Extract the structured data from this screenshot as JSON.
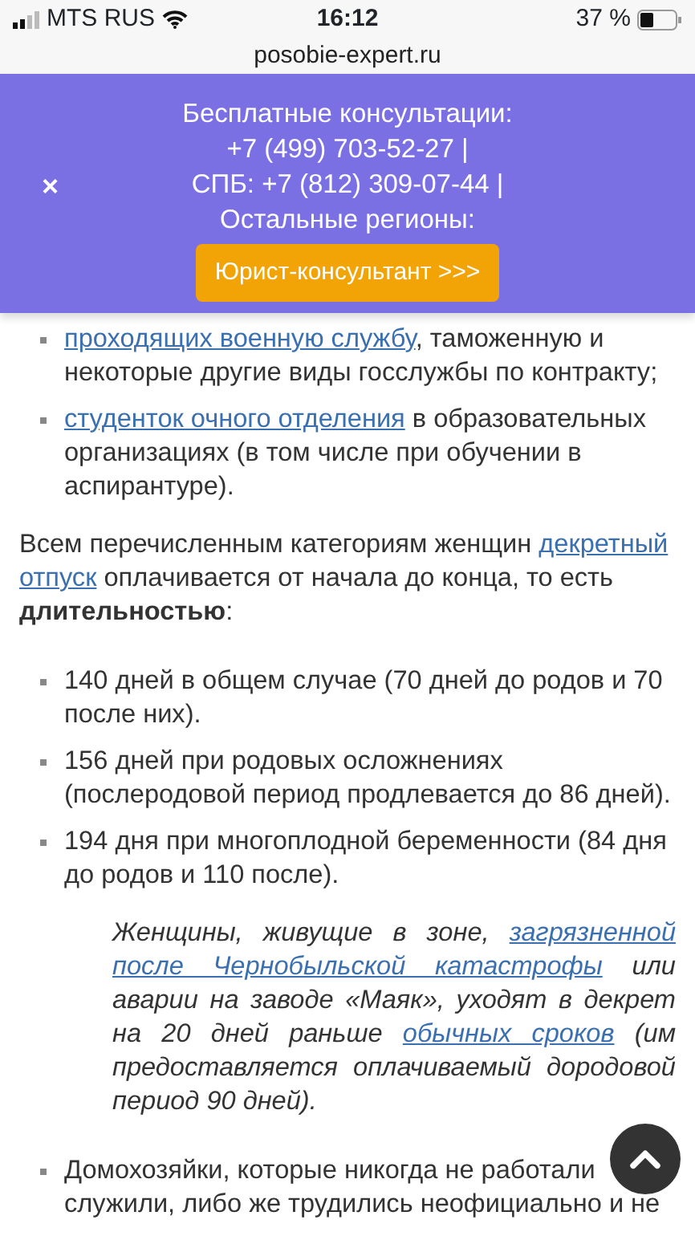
{
  "status_bar": {
    "carrier": "MTS RUS",
    "time": "16:12",
    "battery": "37 %"
  },
  "address_bar": {
    "url": "posobie-expert.ru"
  },
  "banner": {
    "close": "×",
    "lines": [
      "Бесплатные консультации:",
      "+7 (499) 703-52-27 |",
      "СПБ: +7 (812) 309-07-44 |",
      "Остальные регионы:"
    ],
    "button": "Юрист-консультант >>>"
  },
  "content": [
    {
      "kind": "bullets",
      "items": [
        [
          {
            "text": "проходящих военную службу",
            "kind": "link"
          },
          {
            "text": ", таможенную и некоторые другие виды госслужбы по контракту;",
            "kind": "text"
          }
        ],
        [
          {
            "text": "студенток очного отделения",
            "kind": "link"
          },
          {
            "text": " в образовательных организациях (в том числе при обучении в аспирантуре).",
            "kind": "text"
          }
        ]
      ]
    },
    {
      "kind": "paragraph",
      "segments": [
        {
          "text": "Всем перечисленным категориям женщин ",
          "kind": "text"
        },
        {
          "text": "декретный",
          "kind": "link"
        },
        {
          "text": "отпуск",
          "kind": "link"
        },
        {
          "text": " оплачивается от начала до конца, то есть ",
          "kind": "text"
        },
        {
          "text": "длительностью",
          "kind": "bold"
        },
        {
          "text": ":",
          "kind": "text"
        }
      ]
    },
    {
      "kind": "bullets",
      "items": [
        [
          {
            "text": "140 дней в общем случае (70 дней до родов и 70 после них).",
            "kind": "text"
          }
        ],
        [
          {
            "text": "156 дней при родовых осложнениях (послеродовой период продлевается до 86 дней).",
            "kind": "text"
          }
        ],
        [
          {
            "text": "194 дня при многоплодной беременности (84 дня до родов и 110 после).",
            "kind": "text"
          }
        ]
      ]
    },
    {
      "kind": "quote",
      "segments": [
        {
          "text": "Женщины, живущие в зоне, ",
          "kind": "text"
        },
        {
          "text": "загрязненной",
          "kind": "link"
        },
        {
          "text": "после Чернобыльской катастрофы",
          "kind": "link"
        },
        {
          "text": " или аварии на заводе «Маяк», уходят в декрет на 20 дней раньше ",
          "kind": "text"
        },
        {
          "text": "обычных сроков",
          "kind": "link"
        },
        {
          "text": " (им предоставляется оплачиваемый дородовой период 90 дней).",
          "kind": "text"
        }
      ]
    },
    {
      "kind": "cut_bullet",
      "lines": [
        "Домохозяйки, которые никогда не работали",
        "служили, либо же трудились неофициально и не"
      ]
    }
  ]
}
